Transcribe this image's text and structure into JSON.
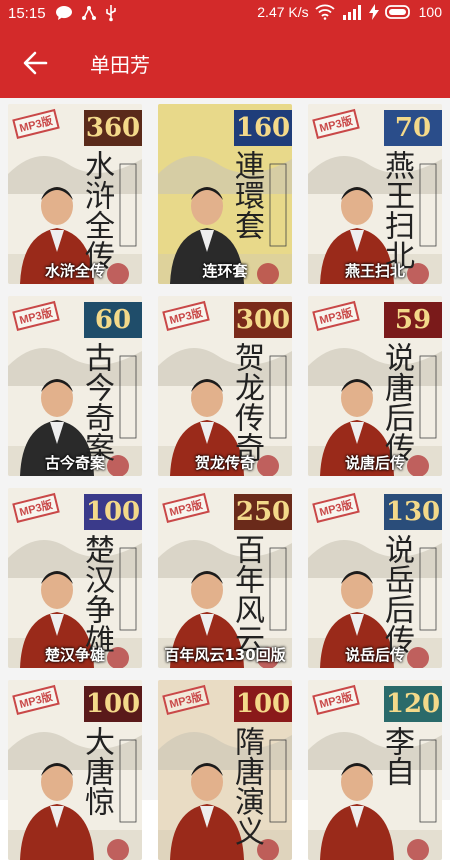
{
  "status": {
    "time": "15:15",
    "speed": "2.47 K/s",
    "battery": "100"
  },
  "appbar": {
    "title": "单田芳"
  },
  "items": [
    {
      "badge": "360",
      "title": "水浒全传",
      "caption": "水浒全传",
      "badge_color": "#5a2a1a",
      "mp3": "MP3版"
    },
    {
      "badge": "160",
      "title": "連環套",
      "caption": "连环套",
      "badge_color": "#1f3d7a",
      "mp3": ""
    },
    {
      "badge": "70",
      "title": "燕王扫北",
      "caption": "燕王扫北",
      "badge_color": "#2a4d8a",
      "mp3": "MP3版"
    },
    {
      "badge": "60",
      "title": "古今奇案",
      "caption": "古今奇案",
      "badge_color": "#1f4d6a",
      "mp3": "MP3版"
    },
    {
      "badge": "300",
      "title": "贺龙传奇",
      "caption": "贺龙传奇",
      "badge_color": "#7a2a1a",
      "mp3": "MP3版"
    },
    {
      "badge": "59",
      "title": "说唐后传",
      "caption": "说唐后传",
      "badge_color": "#7a1a1a",
      "mp3": "MP3版"
    },
    {
      "badge": "100",
      "title": "楚汉争雄",
      "caption": "楚汉争雄",
      "badge_color": "#3a3a8a",
      "mp3": "MP3版"
    },
    {
      "badge": "250",
      "title": "百年风云",
      "caption": "百年风云130回版",
      "badge_color": "#6a2a1a",
      "mp3": "MP3版"
    },
    {
      "badge": "130",
      "title": "说岳后传",
      "caption": "说岳后传",
      "badge_color": "#2a4d7a",
      "mp3": "MP3版"
    },
    {
      "badge": "100",
      "title": "大唐惊",
      "caption": "",
      "badge_color": "#5a1a1a",
      "mp3": "MP3版"
    },
    {
      "badge": "100",
      "title": "隋唐演义",
      "caption": "",
      "badge_color": "#8a1a1a",
      "mp3": "MP3版"
    },
    {
      "badge": "120",
      "title": "李自",
      "caption": "",
      "badge_color": "#2a6a6a",
      "mp3": "MP3版"
    }
  ],
  "icons": {
    "back": "arrow-left-icon",
    "message": "chat-bubble-icon",
    "usb": "usb-icon",
    "wifi": "wifi-icon",
    "signal": "signal-icon",
    "charging": "bolt-icon",
    "battery": "battery-icon"
  }
}
